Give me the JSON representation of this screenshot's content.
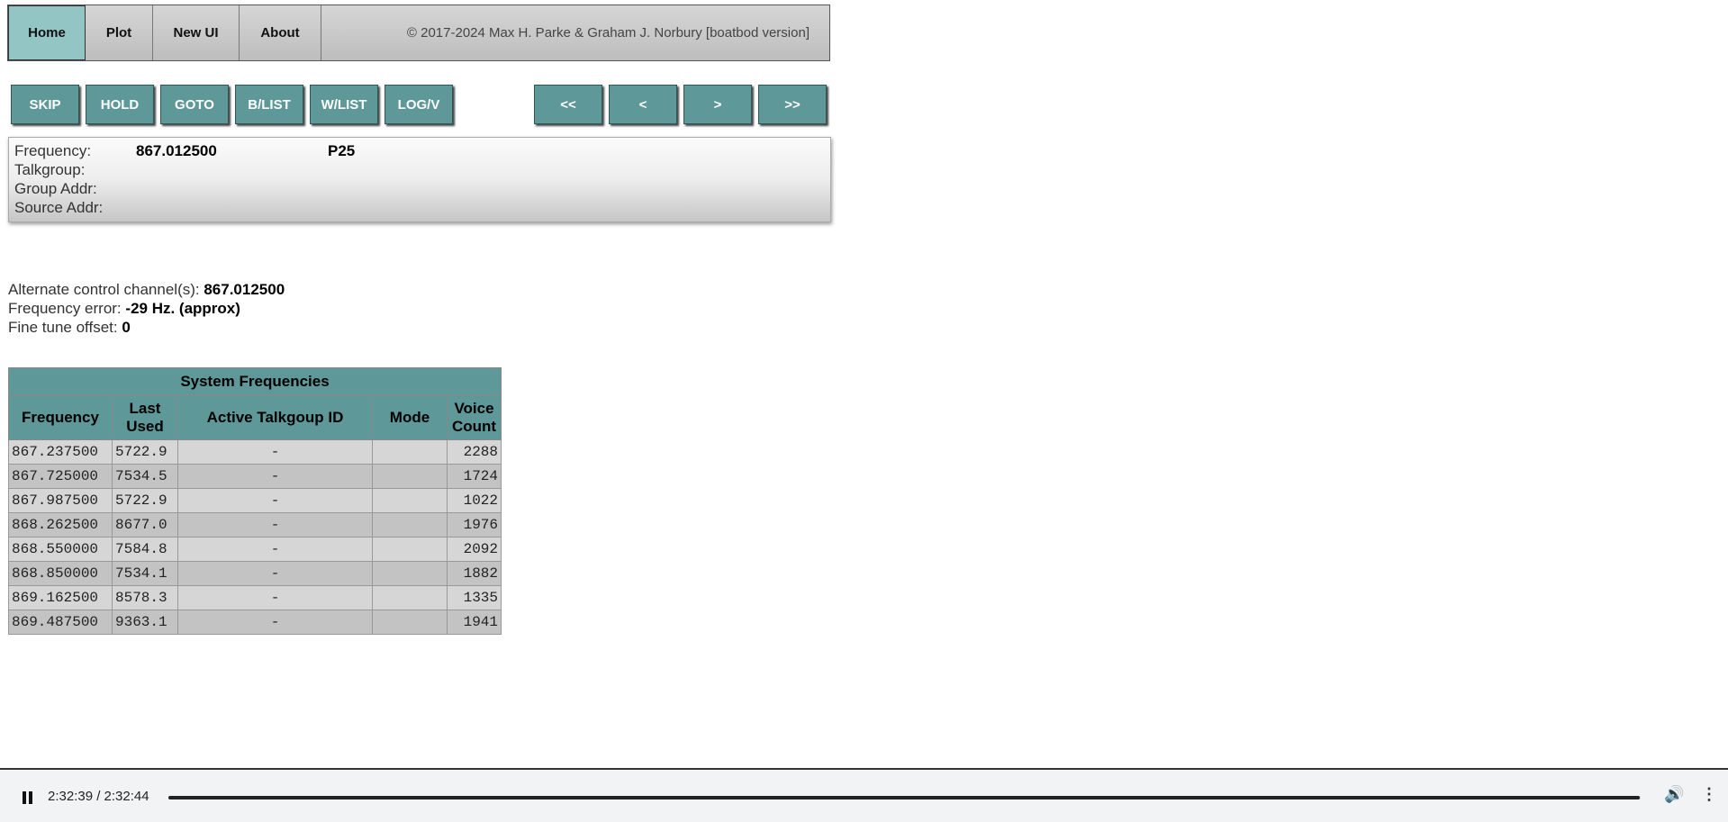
{
  "nav": {
    "tabs": [
      "Home",
      "Plot",
      "New UI",
      "About"
    ],
    "active": "Home",
    "copyright": "© 2017-2024 Max H. Parke & Graham J. Norbury [boatbod version]"
  },
  "controls": {
    "skip": "SKIP",
    "hold": "HOLD",
    "goto": "GOTO",
    "blist": "B/LIST",
    "wlist": "W/LIST",
    "logv": "LOG/V",
    "first": "<<",
    "prev": "<",
    "next": ">",
    "last": ">>"
  },
  "info": {
    "frequency_label": "Frequency:",
    "frequency_value": "867.012500",
    "protocol": "P25",
    "talkgroup_label": "Talkgroup:",
    "group_addr_label": "Group Addr:",
    "source_addr_label": "Source Addr:"
  },
  "stats": {
    "alt_cc_label": "Alternate control channel(s):",
    "alt_cc_value": "867.012500",
    "freq_error_label": "Frequency error:",
    "freq_error_value": "-29 Hz. (approx)",
    "fine_tune_label": "Fine tune offset:",
    "fine_tune_value": "0"
  },
  "table": {
    "caption": "System Frequencies",
    "headers": {
      "frequency": "Frequency",
      "last_used_1": "Last",
      "last_used_2": "Used",
      "active_tg": "Active Talkgoup ID",
      "mode": "Mode",
      "voice_count_1": "Voice",
      "voice_count_2": "Count"
    },
    "rows": [
      {
        "freq": "867.237500",
        "last": "5722.9",
        "tg": "-",
        "mode": "",
        "count": "2288"
      },
      {
        "freq": "867.725000",
        "last": "7534.5",
        "tg": "-",
        "mode": "",
        "count": "1724"
      },
      {
        "freq": "867.987500",
        "last": "5722.9",
        "tg": "-",
        "mode": "",
        "count": "1022"
      },
      {
        "freq": "868.262500",
        "last": "8677.0",
        "tg": "-",
        "mode": "",
        "count": "1976"
      },
      {
        "freq": "868.550000",
        "last": "7584.8",
        "tg": "-",
        "mode": "",
        "count": "2092"
      },
      {
        "freq": "868.850000",
        "last": "7534.1",
        "tg": "-",
        "mode": "",
        "count": "1882"
      },
      {
        "freq": "869.162500",
        "last": "8578.3",
        "tg": "-",
        "mode": "",
        "count": "1335"
      },
      {
        "freq": "869.487500",
        "last": "9363.1",
        "tg": "-",
        "mode": "",
        "count": "1941"
      }
    ]
  },
  "media": {
    "time": "2:32:39 / 2:32:44",
    "progress": 0.9995,
    "icons": [
      "pause-icon",
      "volume-icon",
      "more-options-icon"
    ]
  }
}
